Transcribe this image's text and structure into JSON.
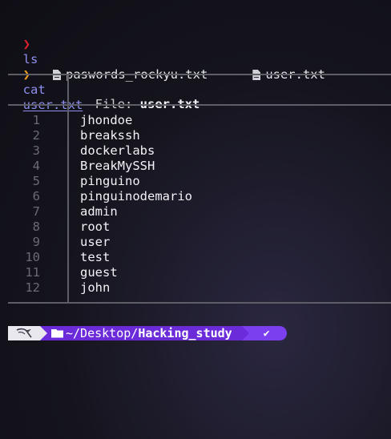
{
  "colors": {
    "prompt_red": "#e0202c",
    "prompt_orange": "#f0a020",
    "command": "#8f8ff0",
    "path_segment": "#6b2bd9",
    "status_segment": "#7c3ff0"
  },
  "history": {
    "prompt_symbol": "❯",
    "cmd1": "ls",
    "ls_files": [
      "paswords_rockyu.txt",
      "user.txt"
    ],
    "cmd2": "cat",
    "cmd2_arg": "user.txt"
  },
  "bat": {
    "header_label": "File: ",
    "header_file": "user.txt",
    "lines": [
      {
        "num": "1",
        "text": "jhondoe"
      },
      {
        "num": "2",
        "text": "breakssh"
      },
      {
        "num": "3",
        "text": "dockerlabs"
      },
      {
        "num": "4",
        "text": "BreakMySSH"
      },
      {
        "num": "5",
        "text": "pinguino"
      },
      {
        "num": "6",
        "text": "pinguinodemario"
      },
      {
        "num": "7",
        "text": "admin"
      },
      {
        "num": "8",
        "text": "root"
      },
      {
        "num": "9",
        "text": "user"
      },
      {
        "num": "10",
        "text": "test"
      },
      {
        "num": "11",
        "text": "guest"
      },
      {
        "num": "12",
        "text": "john"
      }
    ]
  },
  "statusbar": {
    "path_prefix": "~/Desktop/",
    "path_current": "Hacking_study",
    "status_mark": "✔"
  }
}
